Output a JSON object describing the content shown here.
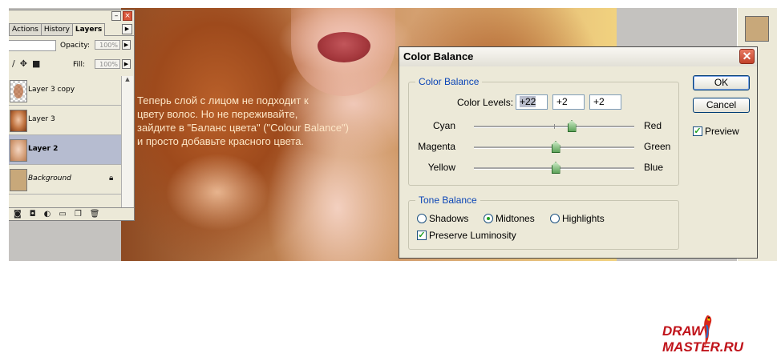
{
  "layers_panel": {
    "tabs": [
      {
        "label": "Actions",
        "active": false
      },
      {
        "label": "History",
        "active": false
      },
      {
        "label": "Layers",
        "active": true
      }
    ],
    "opacity_label": "Opacity:",
    "opacity_value": "100%",
    "fill_label": "Fill:",
    "fill_value": "100%",
    "layers": [
      {
        "name": "Layer 3 copy",
        "selected": false
      },
      {
        "name": "Layer 3",
        "selected": false
      },
      {
        "name": "Layer 2",
        "selected": true
      },
      {
        "name": "Background",
        "selected": false,
        "locked": true
      }
    ]
  },
  "instruction_text": "Теперь слой с лицом не подходит к\nцвету волос. Но не переживайте,\nзайдите в \"Баланс цвета\" (\"Colour Balance\")\nи просто добавьте красного цвета.",
  "dialog": {
    "title": "Color Balance",
    "color_balance_group": "Color Balance",
    "color_levels_label": "Color Levels:",
    "color_levels": [
      "+22",
      "+2",
      "+2"
    ],
    "sliders": [
      {
        "left": "Cyan",
        "right": "Red",
        "value": 22
      },
      {
        "left": "Magenta",
        "right": "Green",
        "value": 2
      },
      {
        "left": "Yellow",
        "right": "Blue",
        "value": 2
      }
    ],
    "slider_range": [
      -100,
      100
    ],
    "tone_balance_group": "Tone Balance",
    "tone_options": [
      {
        "label": "Shadows",
        "selected": false
      },
      {
        "label": "Midtones",
        "selected": true
      },
      {
        "label": "Highlights",
        "selected": false
      }
    ],
    "preserve_luminosity_label": "Preserve Luminosity",
    "preserve_luminosity": true,
    "ok_label": "OK",
    "cancel_label": "Cancel",
    "preview_label": "Preview",
    "preview": true
  },
  "logo": {
    "left": "DRAW",
    "right": "MASTER.RU"
  },
  "colors": {
    "accent": "#0b45b6",
    "selected_layer": "#b6bcd0",
    "logo": "#c0131a",
    "instruction": "#fde6c6"
  }
}
